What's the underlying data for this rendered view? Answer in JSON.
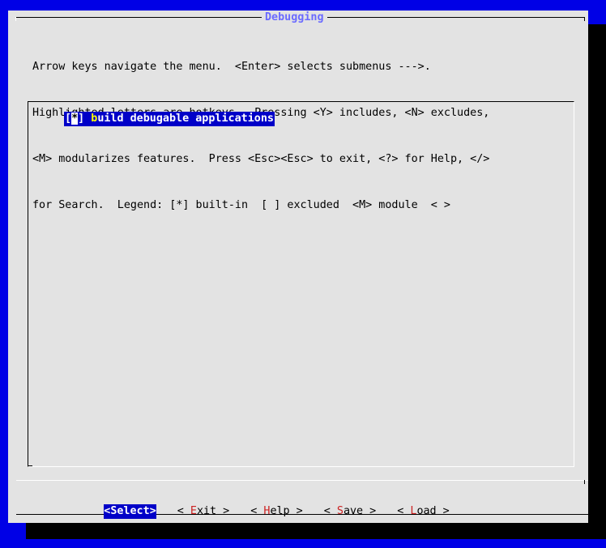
{
  "dialog": {
    "title": "Debugging",
    "help_lines": [
      "Arrow keys navigate the menu.  <Enter> selects submenus --->.",
      "Highlighted letters are hotkeys.  Pressing <Y> includes, <N> excludes,",
      "<M> modularizes features.  Press <Esc><Esc> to exit, <?> for Help, </>",
      "for Search.  Legend: [*] built-in  [ ] excluded  <M> module  < >"
    ]
  },
  "menu": {
    "items": [
      {
        "open": "[",
        "mark": "*",
        "close": "] ",
        "hotkey": "b",
        "rest": "uild debugable applications"
      }
    ]
  },
  "buttons": [
    {
      "pre": "<",
      "hotkey": "Select",
      "post": ">"
    },
    {
      "pre": "< ",
      "hotkey": "E",
      "post": "xit >"
    },
    {
      "pre": "< ",
      "hotkey": "H",
      "post": "elp >"
    },
    {
      "pre": "< ",
      "hotkey": "S",
      "post": "ave >"
    },
    {
      "pre": "< ",
      "hotkey": "L",
      "post": "oad >"
    }
  ],
  "colors": {
    "background": "#0000e6",
    "dialog": "#e3e3e3",
    "title": "#6b6bff",
    "highlight": "#0000c8",
    "hotkey": "#cc2222"
  }
}
